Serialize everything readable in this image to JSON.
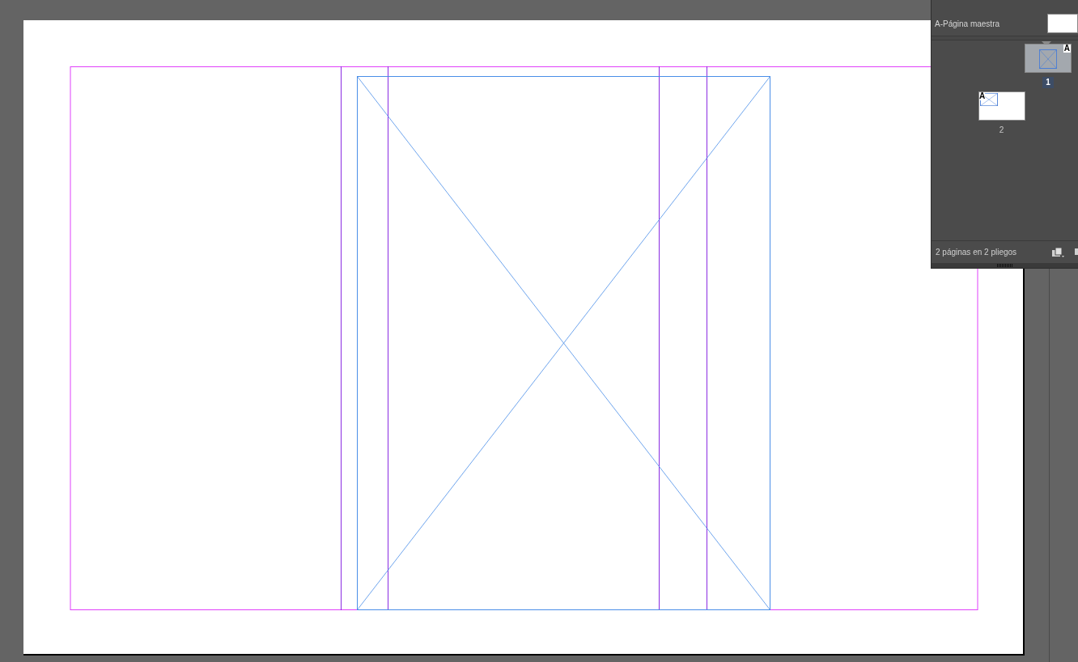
{
  "pages_panel": {
    "masters": [
      {
        "label": "A-Página maestra"
      }
    ],
    "pages": [
      {
        "number": "1",
        "master_prefix": "A",
        "kind": "recto",
        "selected": true
      },
      {
        "number": "2",
        "master_prefix": "A",
        "kind": "verso",
        "selected": false
      }
    ],
    "status": "2 páginas en 2 pliegos"
  }
}
